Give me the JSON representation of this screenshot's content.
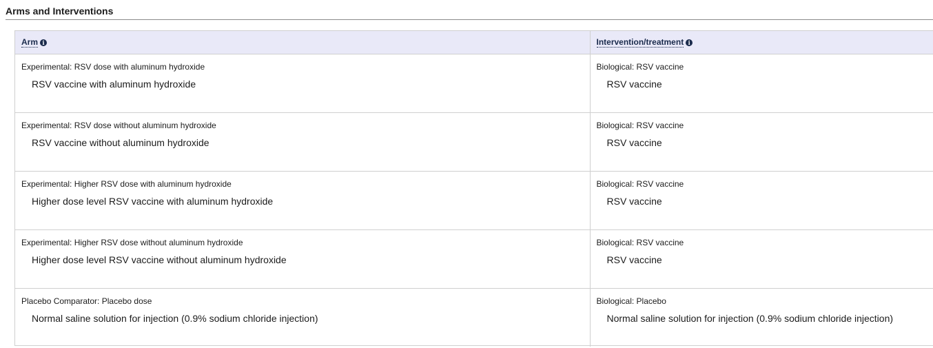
{
  "section": {
    "title": "Arms and Interventions"
  },
  "table": {
    "headers": {
      "arm": "Arm",
      "intervention": "Intervention/treatment"
    },
    "info_icon_glyph": "i",
    "rows": [
      {
        "arm_label": "Experimental: RSV dose with aluminum hydroxide",
        "arm_desc": "RSV vaccine with aluminum hydroxide",
        "intervention_label": "Biological: RSV vaccine",
        "intervention_desc": "RSV vaccine"
      },
      {
        "arm_label": "Experimental: RSV dose without aluminum hydroxide",
        "arm_desc": "RSV vaccine without aluminum hydroxide",
        "intervention_label": "Biological: RSV vaccine",
        "intervention_desc": "RSV vaccine"
      },
      {
        "arm_label": "Experimental: Higher RSV dose with aluminum hydroxide",
        "arm_desc": "Higher dose level RSV vaccine with aluminum hydroxide",
        "intervention_label": "Biological: RSV vaccine",
        "intervention_desc": "RSV vaccine"
      },
      {
        "arm_label": "Experimental: Higher RSV dose without aluminum hydroxide",
        "arm_desc": "Higher dose level RSV vaccine without aluminum hydroxide",
        "intervention_label": "Biological: RSV vaccine",
        "intervention_desc": "RSV vaccine"
      },
      {
        "arm_label": "Placebo Comparator: Placebo dose",
        "arm_desc": "Normal saline solution for injection (0.9% sodium chloride injection)",
        "intervention_label": "Biological: Placebo",
        "intervention_desc": "Normal saline solution for injection (0.9% sodium chloride injection)"
      }
    ]
  },
  "colors": {
    "header_bg": "#e9e9f8",
    "header_text": "#1a2b4c",
    "border": "#cfcfcf"
  }
}
